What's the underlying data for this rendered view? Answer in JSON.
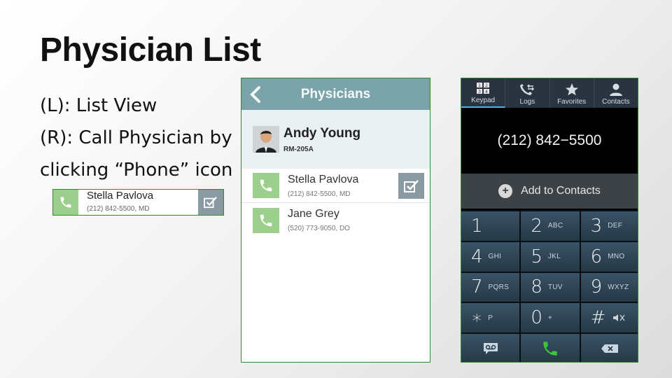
{
  "slide": {
    "title": "Physician List",
    "bullets": [
      "(L): List View",
      "(R): Call Physician by",
      "clicking “Phone” icon"
    ]
  },
  "mini_row": {
    "name": "Stella Pavlova",
    "detail": "(212) 842-5500, MD"
  },
  "list_screen": {
    "header_title": "Physicians",
    "selected": {
      "name": "Andy Young",
      "room": "RM-205A"
    },
    "rows": [
      {
        "name": "Stella Pavlova",
        "detail": "(212) 842-5500, MD"
      },
      {
        "name": "Jane Grey",
        "detail": "(520) 773-9050, DO"
      }
    ]
  },
  "dialer": {
    "tabs": [
      {
        "label": "Keypad",
        "icon": "keypad-icon",
        "active": true
      },
      {
        "label": "Logs",
        "icon": "call-log-icon"
      },
      {
        "label": "Favorites",
        "icon": "star-icon"
      },
      {
        "label": "Contacts",
        "icon": "person-icon"
      }
    ],
    "number": "(212) 842−5500",
    "add_contacts": "Add to Contacts",
    "keys": [
      {
        "d": "1",
        "l": ""
      },
      {
        "d": "2",
        "l": "ABC"
      },
      {
        "d": "3",
        "l": "DEF"
      },
      {
        "d": "4",
        "l": "GHI"
      },
      {
        "d": "5",
        "l": "JKL"
      },
      {
        "d": "6",
        "l": "MNO"
      },
      {
        "d": "7",
        "l": "PQRS"
      },
      {
        "d": "8",
        "l": "TUV"
      },
      {
        "d": "9",
        "l": "WXYZ"
      },
      {
        "d": "∗",
        "l": "P"
      },
      {
        "d": "0",
        "l": "+"
      },
      {
        "d": "#",
        "l": ""
      }
    ]
  },
  "colors": {
    "green_border": "#2e8b2e",
    "phone_button": "#9ccf8e",
    "check_button": "#8a9aa2",
    "header_teal": "#7ba3aa",
    "call_green": "#3cc43c"
  }
}
